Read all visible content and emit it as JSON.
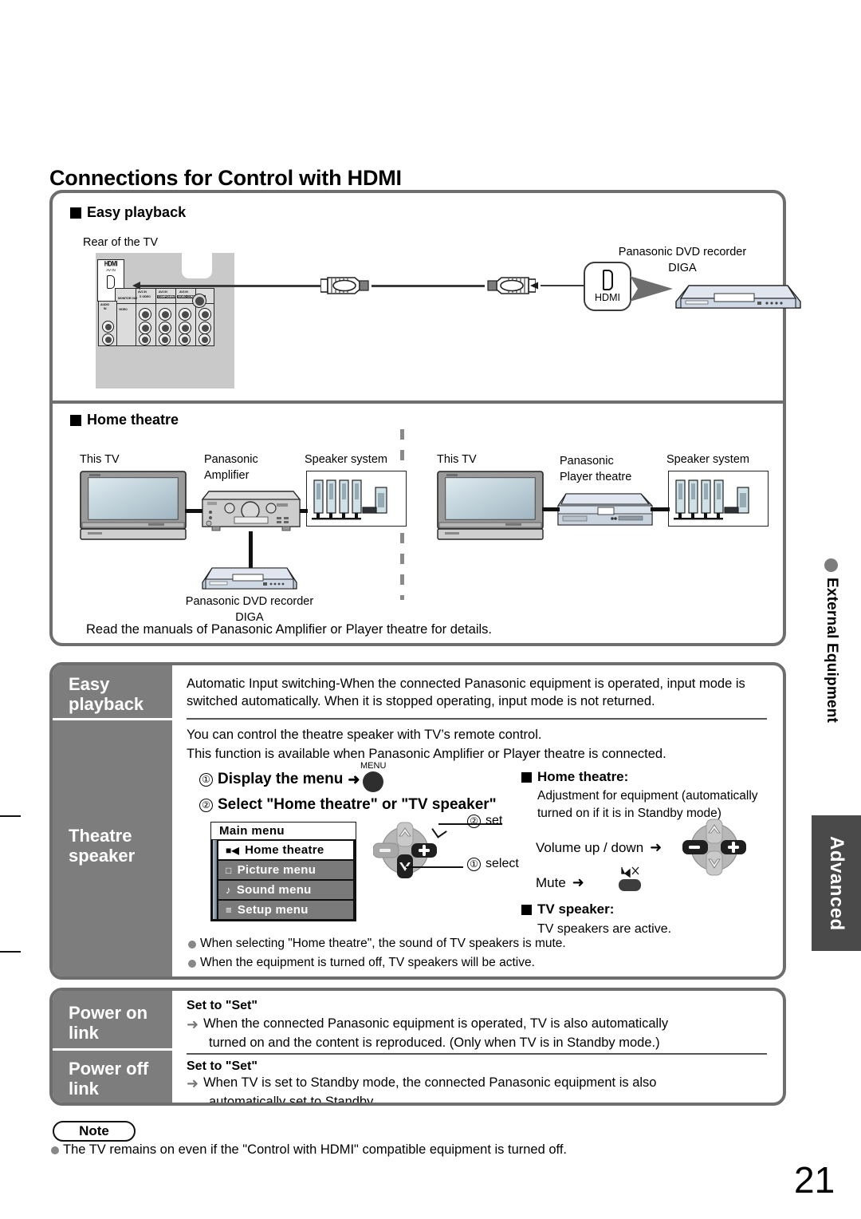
{
  "page": {
    "title": "Connections for Control with HDMI",
    "number": "21"
  },
  "side_tabs": {
    "chapter_label": "External Equipment",
    "section_label": "Advanced"
  },
  "easy_playback_diagram": {
    "heading": "Easy playback",
    "tv_label": "Rear of the TV",
    "tv_port_brand": "HDMI",
    "tv_port_sub": "AV IN",
    "callout_label": "HDMI",
    "device_label_line1": "Panasonic DVD recorder",
    "device_label_line2": "DIGA",
    "jack_labels": [
      "AUDIO IN",
      "MONITOR OUT",
      "AV1 IN",
      "S VIDEO",
      "AV2 IN",
      "AV3 IN",
      "COMPONENT",
      "VIDEO COMPONENT",
      "VIDEO",
      "AUDIO",
      "L",
      "R",
      "Y",
      "PB",
      "PR"
    ]
  },
  "home_theatre_diagram": {
    "heading": "Home theatre",
    "left": {
      "tv_label": "This TV",
      "amp_label_line1": "Panasonic",
      "amp_label_line2": "Amplifier",
      "speaker_label": "Speaker system",
      "recorder_label_line1": "Panasonic DVD recorder",
      "recorder_label_line2": "DIGA"
    },
    "right": {
      "tv_label": "This TV",
      "player_label_line1": "Panasonic",
      "player_label_line2": "Player theatre",
      "speaker_label": "Speaker system"
    },
    "footer_note": "Read the manuals of Panasonic Amplifier or Player theatre for details."
  },
  "features": {
    "easy_playback": {
      "label_line1": "Easy",
      "label_line2": "playback",
      "description": "Automatic Input switching-When the connected Panasonic equipment is operated, input mode is switched automatically. When it is stopped operating, input mode is not returned."
    },
    "theatre_speaker": {
      "label_line1": "Theatre",
      "label_line2": "speaker",
      "intro_line1": "You can control the theatre speaker with TV’s remote control.",
      "intro_line2": "This function is available when Panasonic Amplifier or Player theatre is connected.",
      "step1_num": "①",
      "step1_text": "Display the menu",
      "step1_arrow": "➜",
      "menu_button_label": "MENU",
      "step2_num": "②",
      "step2_text": "Select \"Home theatre\" or \"TV speaker\"",
      "osd": {
        "title": "Main menu",
        "items": [
          {
            "icon": "speaker-icon",
            "glyph": "■◀",
            "label": "Home theatre",
            "selected": true
          },
          {
            "icon": "picture-icon",
            "glyph": "□",
            "label": "Picture menu",
            "selected": false
          },
          {
            "icon": "sound-icon",
            "glyph": "♪",
            "label": "Sound menu",
            "selected": false
          },
          {
            "icon": "setup-icon",
            "glyph": "≡",
            "label": "Setup menu",
            "selected": false
          }
        ]
      },
      "pad_callouts": {
        "set_num": "②",
        "set_label": "set",
        "select_num": "①",
        "select_label": "select"
      },
      "home_theatre_heading": "Home theatre:",
      "home_theatre_line1": "Adjustment for equipment (automatically",
      "home_theatre_line2": "turned on if it is in Standby mode)",
      "volume_label": "Volume up / down",
      "volume_arrow": "➜",
      "mute_label": "Mute",
      "mute_arrow": "➜",
      "tv_speaker_heading": "TV speaker:",
      "tv_speaker_line": "TV speakers are active.",
      "bullets": [
        "When selecting \"Home theatre\", the sound of TV speakers is mute.",
        "When the equipment is turned off, TV speakers will be active."
      ]
    },
    "power_on_link": {
      "label_line1": "Power on",
      "label_line2": "link",
      "set_heading": "Set to \"Set\"",
      "arrow": "➜",
      "body_line1": "When the connected Panasonic equipment is operated, TV is also automatically",
      "body_line2": "turned on and the content is reproduced. (Only when TV is in Standby mode.)"
    },
    "power_off_link": {
      "label_line1": "Power off",
      "label_line2": "link",
      "set_heading": "Set to \"Set\"",
      "arrow": "➜",
      "body_line1": "When TV is set to Standby mode, the connected Panasonic equipment is also",
      "body_line2": "automatically set to Standby."
    }
  },
  "note": {
    "label": "Note",
    "items": [
      "The TV remains on even if the \"Control with HDMI\" compatible equipment is turned off."
    ]
  },
  "colors": {
    "panel_border": "#6e6e6e",
    "label_cell": "#7d7d7d",
    "advanced_tab": "#4a4a4a",
    "bullet_dot": "#888888"
  }
}
